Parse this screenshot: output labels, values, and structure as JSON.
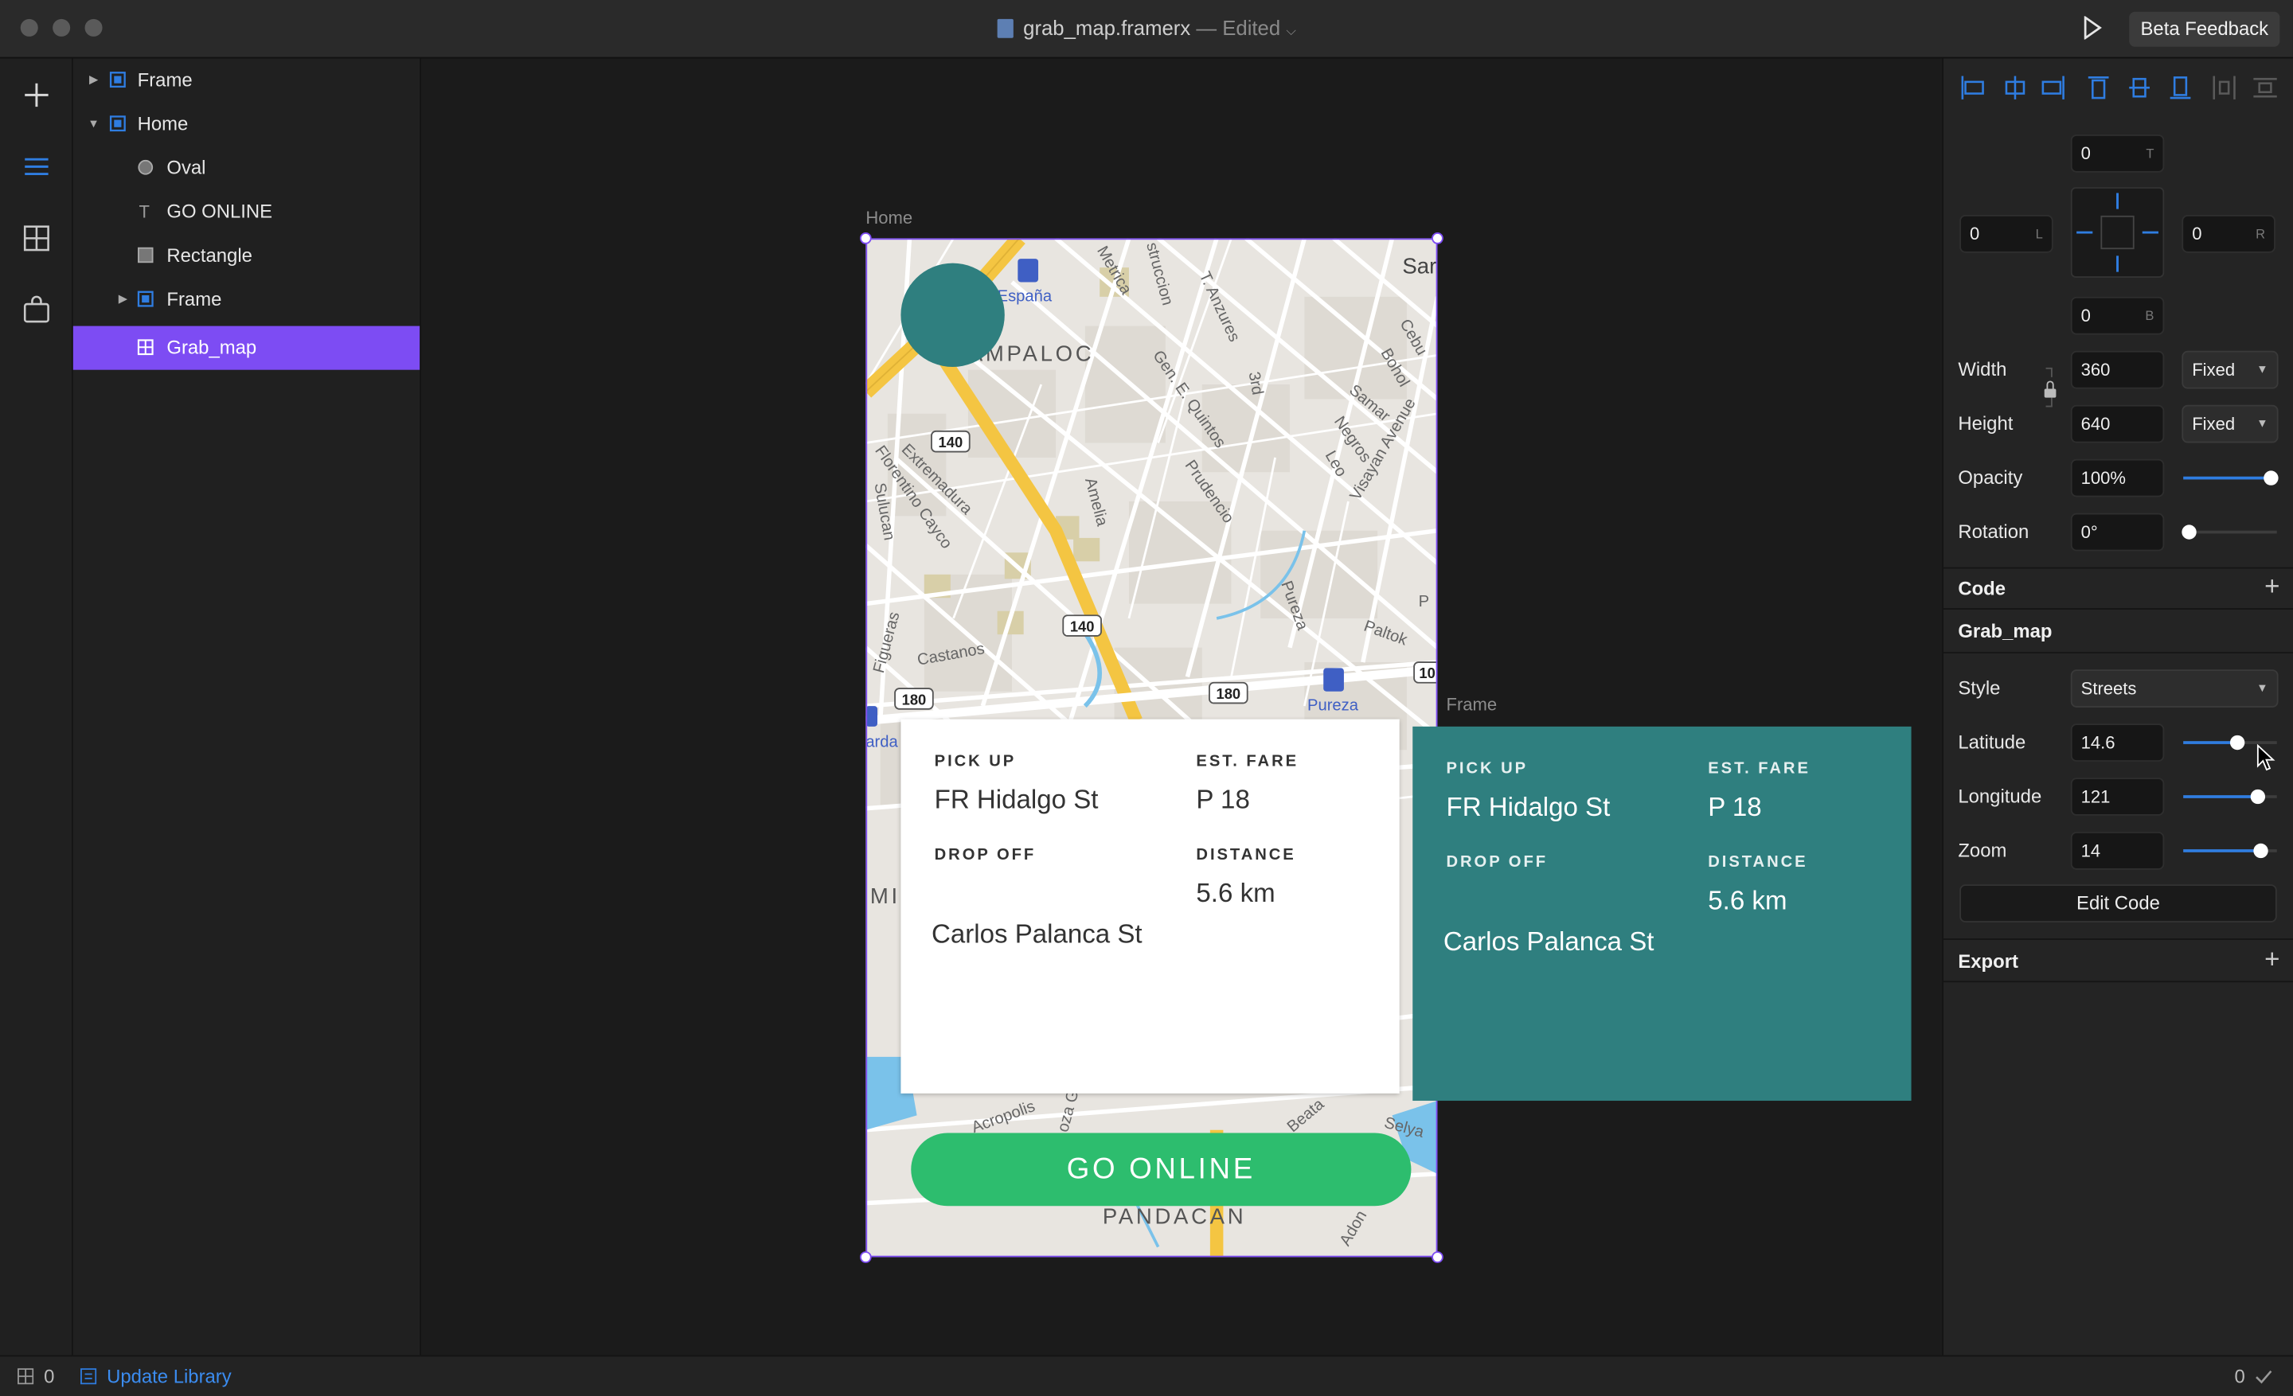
{
  "window": {
    "file_name": "grab_map.framerx",
    "status": "— Edited",
    "beta_button": "Beta Feedback"
  },
  "layers": [
    {
      "label": "Frame",
      "icon": "frame-icon",
      "expanded": false
    },
    {
      "label": "Home",
      "icon": "frame-icon",
      "expanded": true
    },
    {
      "label": "Oval",
      "icon": "oval-icon"
    },
    {
      "label": "GO ONLINE",
      "icon": "text-icon"
    },
    {
      "label": "Rectangle",
      "icon": "rectangle-icon"
    },
    {
      "label": "Frame",
      "icon": "frame-icon",
      "expanded": false
    },
    {
      "label": "Grab_map",
      "icon": "component-icon",
      "selected": true
    }
  ],
  "canvas": {
    "home_label": "Home",
    "frame_label": "Frame",
    "map": {
      "labels": [
        "España",
        "AMPALOC",
        "Sar",
        "Metrica",
        "struccion",
        "T. Anzures",
        "Cebu",
        "Bohol",
        "Gen. E. Quintos",
        "3rd",
        "Samar",
        "Negros",
        "Visayan Avenue",
        "Extremadura",
        "Florentino Cayco",
        "Amelia",
        "Prudencio",
        "Leo",
        "Sulucan",
        "Pureza",
        "Paltok",
        "Figueras",
        "Castanos",
        "P",
        "MI",
        "arda",
        "Acropolis",
        "Beata",
        "Selya",
        "PANDACAN",
        "Adon",
        "oza G",
        "Pureza"
      ],
      "road_badges": [
        "140",
        "140",
        "180",
        "180",
        "10"
      ]
    },
    "card": {
      "pickup_label": "PICK UP",
      "pickup_value": "FR Hidalgo St",
      "fare_label": "EST. FARE",
      "fare_value": "P 18",
      "dropoff_label": "DROP OFF",
      "dropoff_value": "Carlos Palanca St",
      "distance_label": "DISTANCE",
      "distance_value": "5.6 km"
    },
    "go_online_label": "GO ONLINE",
    "colors": {
      "teal": "#2f7f7f",
      "green": "#2dbd6e",
      "selection": "#7d4cf3"
    }
  },
  "properties": {
    "pin": {
      "top": "0",
      "left": "0",
      "right": "0",
      "bottom": "0",
      "top_suffix": "T",
      "left_suffix": "L",
      "right_suffix": "R",
      "bottom_suffix": "B"
    },
    "width_label": "Width",
    "width_value": "360",
    "width_mode": "Fixed",
    "height_label": "Height",
    "height_value": "640",
    "height_mode": "Fixed",
    "opacity_label": "Opacity",
    "opacity_value": "100%",
    "opacity_level": 1.0,
    "rotation_label": "Rotation",
    "rotation_value": "0°",
    "rotation_level": 0,
    "code_label": "Code",
    "component_name": "Grab_map",
    "style_label": "Style",
    "style_value": "Streets",
    "latitude_label": "Latitude",
    "latitude_value": "14.6",
    "latitude_level": 0.58,
    "longitude_label": "Longitude",
    "longitude_value": "121",
    "longitude_level": 0.8,
    "zoom_label": "Zoom",
    "zoom_value": "14",
    "zoom_level": 0.83,
    "edit_code_button": "Edit Code",
    "export_label": "Export"
  },
  "status_bar": {
    "grid_count": "0",
    "update_library": "Update Library",
    "right_count": "0"
  }
}
